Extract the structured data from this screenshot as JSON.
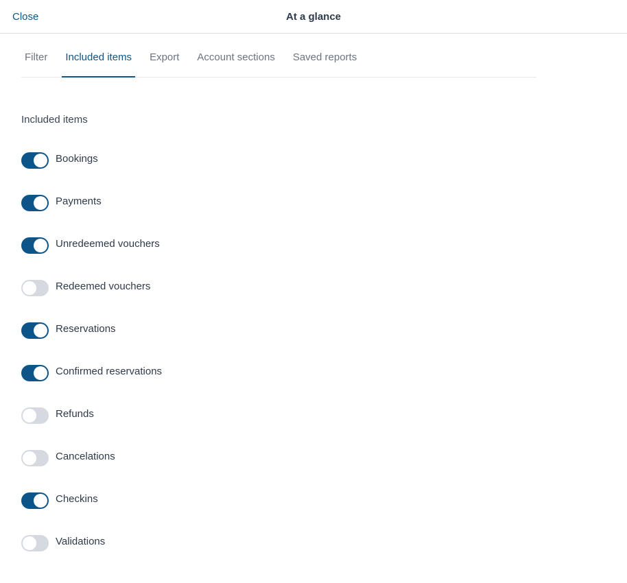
{
  "header": {
    "close_label": "Close",
    "title": "At a glance"
  },
  "tabs": [
    {
      "label": "Filter",
      "active": false
    },
    {
      "label": "Included items",
      "active": true
    },
    {
      "label": "Export",
      "active": false
    },
    {
      "label": "Account sections",
      "active": false
    },
    {
      "label": "Saved reports",
      "active": false
    }
  ],
  "section": {
    "heading": "Included items"
  },
  "toggles": [
    {
      "label": "Bookings",
      "on": true
    },
    {
      "label": "Payments",
      "on": true
    },
    {
      "label": "Unredeemed vouchers",
      "on": true
    },
    {
      "label": "Redeemed vouchers",
      "on": false
    },
    {
      "label": "Reservations",
      "on": true
    },
    {
      "label": "Confirmed reservations",
      "on": true
    },
    {
      "label": "Refunds",
      "on": false
    },
    {
      "label": "Cancelations",
      "on": false
    },
    {
      "label": "Checkins",
      "on": true
    },
    {
      "label": "Validations",
      "on": false
    }
  ],
  "colors": {
    "accent": "#0d5588",
    "toggle_off": "#d6dae0",
    "text": "#2f3a4a",
    "muted": "#6b7480"
  }
}
